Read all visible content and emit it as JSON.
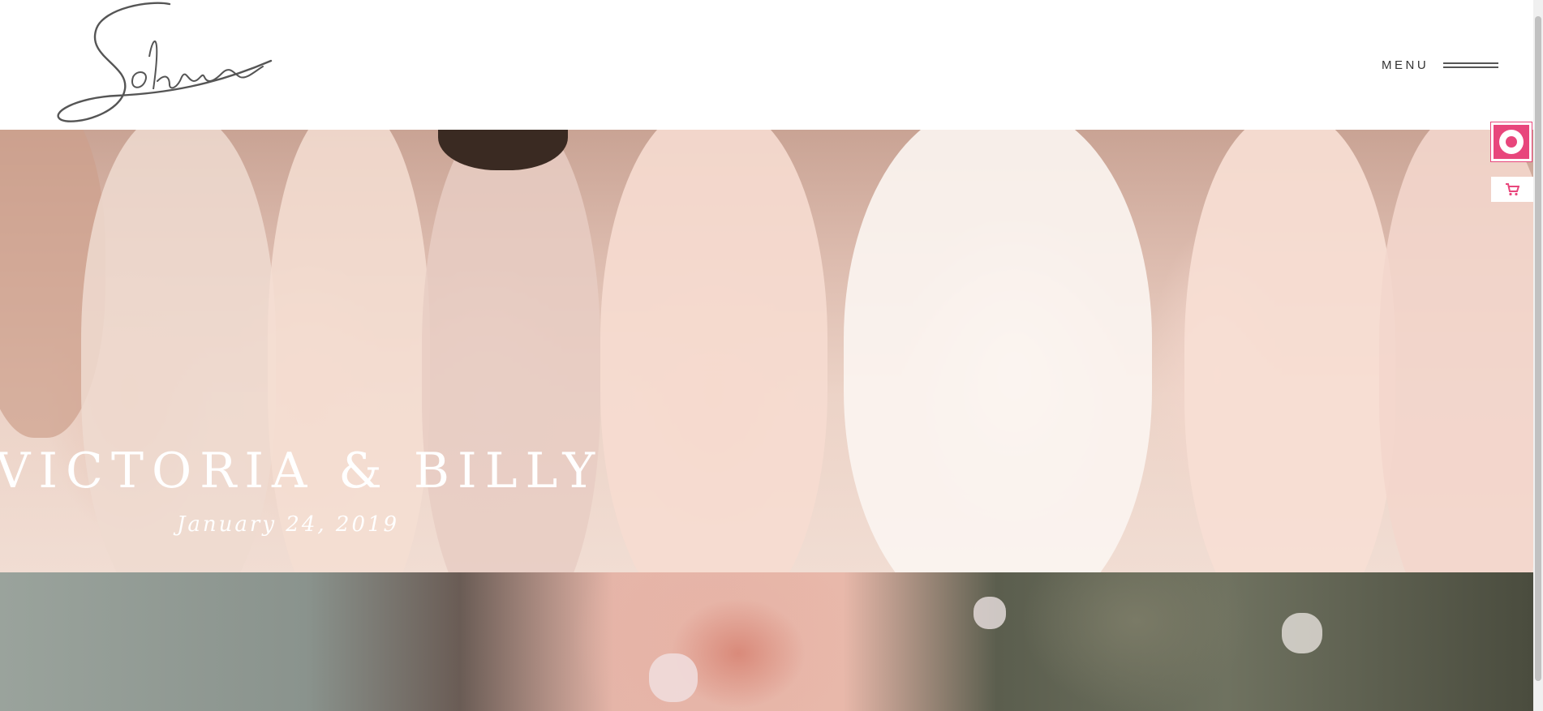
{
  "header": {
    "logo_text": "Solene",
    "menu_label": "MENU"
  },
  "hero": {
    "title": "VICTORIA & BILLY",
    "date": "January 24, 2019"
  },
  "icons": {
    "menu": "hamburger-lines-icon",
    "widget": "ring-logo-icon",
    "cart": "cart-icon"
  },
  "colors": {
    "accent": "#e8467c",
    "text_dark": "#333333",
    "hero_text": "#ffffff"
  }
}
